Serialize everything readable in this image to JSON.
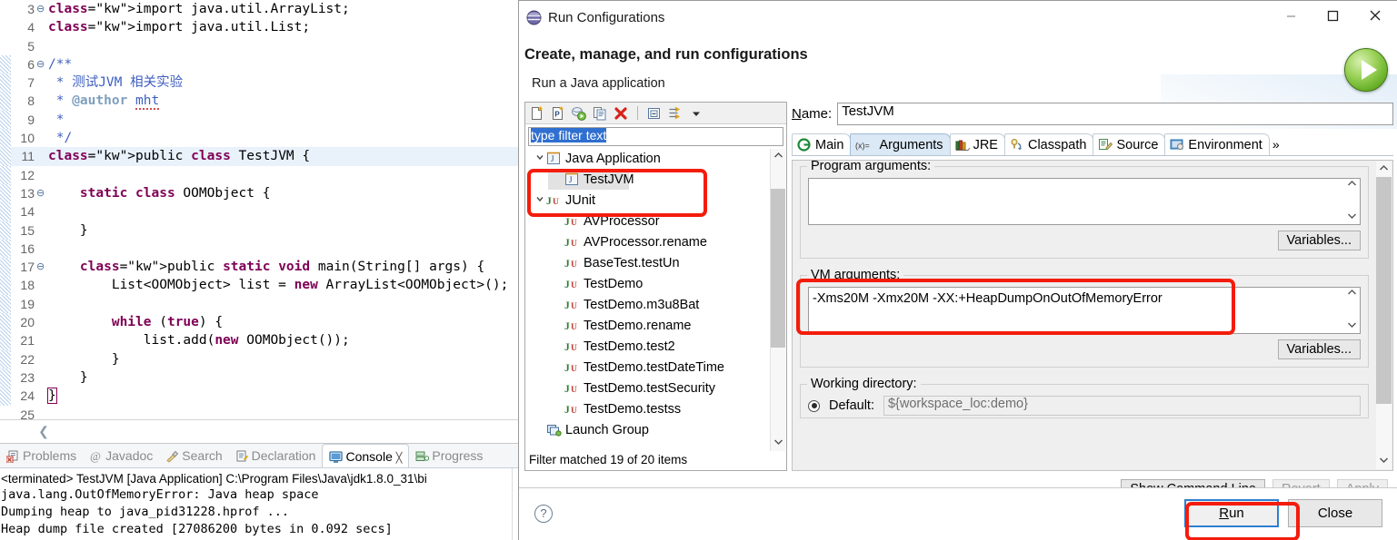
{
  "editor": {
    "lines": [
      {
        "num": "3",
        "fold": true,
        "html": "import_arraylist"
      },
      {
        "num": "4",
        "fold": false,
        "html": "import_list"
      },
      {
        "num": "5",
        "fold": false,
        "html": "blank"
      },
      {
        "num": "6",
        "fold": true,
        "html": "comment_open"
      },
      {
        "num": "7",
        "fold": false,
        "html": "comment_desc"
      },
      {
        "num": "8",
        "fold": false,
        "html": "comment_author"
      },
      {
        "num": "9",
        "fold": false,
        "html": "comment_star"
      },
      {
        "num": "10",
        "fold": false,
        "html": "comment_close"
      },
      {
        "num": "11",
        "fold": false,
        "html": "class_decl"
      },
      {
        "num": "12",
        "fold": false,
        "html": "blank"
      },
      {
        "num": "13",
        "fold": true,
        "html": "static_class"
      },
      {
        "num": "14",
        "fold": false,
        "html": "blank"
      },
      {
        "num": "15",
        "fold": false,
        "html": "close_brace_1"
      },
      {
        "num": "16",
        "fold": false,
        "html": "blank"
      },
      {
        "num": "17",
        "fold": true,
        "html": "main_decl"
      },
      {
        "num": "18",
        "fold": false,
        "html": "list_decl"
      },
      {
        "num": "19",
        "fold": false,
        "html": "blank"
      },
      {
        "num": "20",
        "fold": false,
        "html": "while_true"
      },
      {
        "num": "21",
        "fold": false,
        "html": "list_add"
      },
      {
        "num": "22",
        "fold": false,
        "html": "close_brace_2"
      },
      {
        "num": "23",
        "fold": false,
        "html": "close_brace_3"
      },
      {
        "num": "24",
        "fold": false,
        "html": "close_brace_4"
      },
      {
        "num": "25",
        "fold": false,
        "html": "blank"
      }
    ],
    "text": {
      "import_arraylist": "import java.util.ArrayList;",
      "import_list": "import java.util.List;",
      "comment_open": "/**",
      "comment_desc": " * 测试JVM 相关实验",
      "comment_author": " * @author mht",
      "comment_star": " *",
      "comment_close": " */",
      "class_decl": "public class TestJVM {",
      "static_class": "    static class OOMObject {",
      "close_brace_1": "    }",
      "main_decl": "    public static void main(String[] args) {",
      "list_decl": "        List<OOMObject> list = new ArrayList<OOMObject>();",
      "while_true": "        while (true) {",
      "list_add": "            list.add(new OOMObject());",
      "close_brace_2": "        }",
      "close_brace_3": "    }",
      "close_brace_4": "}"
    }
  },
  "console": {
    "tabs": [
      {
        "label": "Problems",
        "icon": "problems-icon",
        "active": false
      },
      {
        "label": "Javadoc",
        "icon": "javadoc-icon",
        "active": false
      },
      {
        "label": "Search",
        "icon": "search-icon",
        "active": false
      },
      {
        "label": "Declaration",
        "icon": "declaration-icon",
        "active": false
      },
      {
        "label": "Console",
        "icon": "console-icon",
        "active": true
      },
      {
        "label": "Progress",
        "icon": "progress-icon",
        "active": false
      }
    ],
    "close_glyph": "✕",
    "header": "<terminated> TestJVM [Java Application] C:\\Program Files\\Java\\jdk1.8.0_31\\bi",
    "output": [
      "java.lang.OutOfMemoryError: Java heap space",
      "Dumping heap to java_pid31228.hprof ...",
      "Heap dump file created [27086200 bytes in 0.092 secs]"
    ]
  },
  "dialog": {
    "window_title": "Run Configurations",
    "window_icon": "eclipse-globe-icon",
    "window_controls": {
      "minimize": "—",
      "maximize": "☐",
      "close": "✕"
    },
    "heading": "Create, manage, and run configurations",
    "subheading": "Run a Java application",
    "run_orb_icon": "green-run-play-icon",
    "toolbar_icons": [
      "new-launch-configuration-icon",
      "new-prototype-icon",
      "export-launch-icon",
      "duplicate-icon",
      "delete-icon",
      "collapse-all-icon",
      "filter-icon",
      "view-menu-chevron-icon"
    ],
    "filter": {
      "value": "type filter text",
      "placeholder": "type filter text",
      "selected": true
    },
    "tree": [
      {
        "label": "Java Application",
        "icon": "java-application-icon",
        "indent": 0,
        "twisty": "v",
        "selected": false
      },
      {
        "label": "TestJVM",
        "icon": "java-application-icon",
        "indent": 1,
        "twisty": "",
        "selected": true
      },
      {
        "label": "JUnit",
        "icon": "junit-icon",
        "indent": 0,
        "twisty": "v",
        "selected": false
      },
      {
        "label": "AVProcessor",
        "icon": "junit-icon",
        "indent": 1,
        "twisty": "",
        "selected": false
      },
      {
        "label": "AVProcessor.rename",
        "icon": "junit-icon",
        "indent": 1,
        "twisty": "",
        "selected": false
      },
      {
        "label": "BaseTest.testUn",
        "icon": "junit-icon",
        "indent": 1,
        "twisty": "",
        "selected": false
      },
      {
        "label": "TestDemo",
        "icon": "junit-icon",
        "indent": 1,
        "twisty": "",
        "selected": false
      },
      {
        "label": "TestDemo.m3u8Bat",
        "icon": "junit-icon",
        "indent": 1,
        "twisty": "",
        "selected": false
      },
      {
        "label": "TestDemo.rename",
        "icon": "junit-icon",
        "indent": 1,
        "twisty": "",
        "selected": false
      },
      {
        "label": "TestDemo.test2",
        "icon": "junit-icon",
        "indent": 1,
        "twisty": "",
        "selected": false
      },
      {
        "label": "TestDemo.testDateTime",
        "icon": "junit-icon",
        "indent": 1,
        "twisty": "",
        "selected": false
      },
      {
        "label": "TestDemo.testSecurity",
        "icon": "junit-icon",
        "indent": 1,
        "twisty": "",
        "selected": false
      },
      {
        "label": "TestDemo.testss",
        "icon": "junit-icon",
        "indent": 1,
        "twisty": "",
        "selected": false
      },
      {
        "label": "Launch Group",
        "icon": "launch-group-icon",
        "indent": 0,
        "twisty": "",
        "selected": false
      }
    ],
    "tree_footer": "Filter matched 19 of 20 items",
    "scroll_up_glyph": "⌃",
    "scroll_down_glyph": "⌄",
    "name_label": "Name:",
    "name_value": "TestJVM",
    "tabs": [
      {
        "label": "Main",
        "icon": "main-tab-icon",
        "active": false
      },
      {
        "label": "Arguments",
        "icon": "arguments-tab-icon",
        "active": true
      },
      {
        "label": "JRE",
        "icon": "jre-tab-icon",
        "active": false
      },
      {
        "label": "Classpath",
        "icon": "classpath-tab-icon",
        "active": false
      },
      {
        "label": "Source",
        "icon": "source-tab-icon",
        "active": false
      },
      {
        "label": "Environment",
        "icon": "environment-tab-icon",
        "active": false
      },
      {
        "label": "»",
        "icon": "more-tabs-icon",
        "active": false
      }
    ],
    "program_arguments": {
      "label": "Program arguments:",
      "value": "",
      "variables_button": "Variables..."
    },
    "vm_arguments": {
      "label": "VM arguments:",
      "value": "-Xms20M  -Xmx20M   -XX:+HeapDumpOnOutOfMemoryError",
      "variables_button": "Variables..."
    },
    "working_directory": {
      "label": "Working directory:",
      "default_label": "Default:",
      "default_value": "${workspace_loc:demo}",
      "default_checked": true
    },
    "action_buttons": {
      "show_command_line": "Show Command Line",
      "revert": "Revert",
      "apply": "Apply",
      "revert_disabled": true,
      "apply_disabled": true
    },
    "footer": {
      "help_icon": "help-question-icon",
      "run": "Run",
      "close": "Close"
    },
    "annotations": {
      "accent_color": "#f41c0c",
      "boxes": [
        "java-application-tree-highlight",
        "vm-arguments-highlight",
        "run-button-highlight"
      ]
    }
  }
}
